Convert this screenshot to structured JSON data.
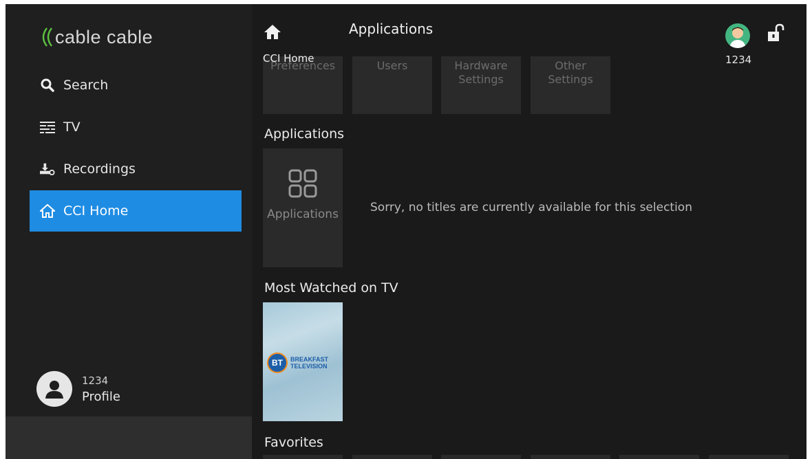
{
  "brand": {
    "logo_text": "cable cable",
    "accent": "#1f8ce3",
    "logo_green": "#5cc241"
  },
  "sidebar": {
    "items": [
      {
        "label": "Search",
        "icon": "search-icon"
      },
      {
        "label": "TV",
        "icon": "tv-guide-icon"
      },
      {
        "label": "Recordings",
        "icon": "recordings-icon"
      },
      {
        "label": "CCI Home",
        "icon": "home-icon",
        "active": true
      }
    ],
    "profile": {
      "number": "1234",
      "label": "Profile"
    }
  },
  "header": {
    "home_label": "CCI Home",
    "title": "Applications",
    "user_number": "1234"
  },
  "top_tiles": [
    {
      "label": "Preferences"
    },
    {
      "label": "Users"
    },
    {
      "label": "Hardware Settings"
    },
    {
      "label": "Other Settings"
    }
  ],
  "sections": {
    "applications": {
      "title": "Applications",
      "tile_label": "Applications",
      "empty_message": "Sorry, no titles are currently available for this selection"
    },
    "most_watched": {
      "title": "Most Watched on TV",
      "poster": {
        "badge": "BT",
        "line1": "BREAKFAST",
        "line2": "TELEVISION"
      }
    },
    "favorites": {
      "title": "Favorites"
    }
  }
}
